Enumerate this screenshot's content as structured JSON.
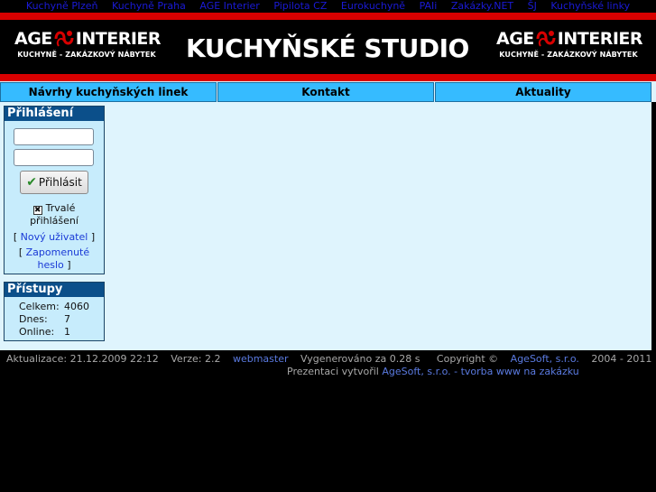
{
  "top_links": [
    "Kuchyně Plzeň",
    "Kuchyně Praha",
    "AGE Interier",
    "Pipilota CZ",
    "Eurokuchyně",
    "PAIi",
    "Zakázky.NET",
    "ŠJ",
    "Kuchyňské linky"
  ],
  "banner": {
    "logo_prefix": "AGE",
    "logo_suffix": "INTERIER",
    "logo_sub": "KUCHYNĚ - ZAKÁZKOVÝ NÁBYTEK",
    "title": "KUCHYŇSKÉ STUDIO"
  },
  "nav": [
    "Návrhy kuchyňských linek",
    "Kontakt",
    "Aktuality"
  ],
  "login": {
    "title": "Přihlášení",
    "username_value": "",
    "password_value": "",
    "submit_label": "Přihlásit",
    "remember_checked": true,
    "remember_label_1": "Trvalé",
    "remember_label_2": "přihlášení",
    "new_user_label": "Nový uživatel",
    "forgot_label_1": "Zapomenuté",
    "forgot_label_2": "heslo",
    "bracket_open": "[",
    "bracket_close": "]"
  },
  "visits": {
    "title": "Přístupy",
    "rows": [
      {
        "label": "Celkem:",
        "value": "4060"
      },
      {
        "label": "Dnes:",
        "value": "7"
      },
      {
        "label": "Online:",
        "value": "1"
      }
    ]
  },
  "footer": {
    "updated": "Aktualizace: 21.12.2009 22:12",
    "version": "Verze: 2.2",
    "webmaster": "webmaster",
    "generated": "Vygenerováno za 0.28 s",
    "copyright_prefix": "Copyright ©",
    "copyright_link": "AgeSoft, s.r.o.",
    "copyright_years": "2004 - 2011",
    "presented_prefix": "Prezentaci vytvořil",
    "presented_link": "AgeSoft, s.r.o. - tvorba www na zakázku"
  },
  "colors": {
    "accent_red": "#d80000",
    "nav_blue": "#36bbff",
    "panel_head": "#0b4f8a",
    "content_bg": "#dff4fd"
  }
}
